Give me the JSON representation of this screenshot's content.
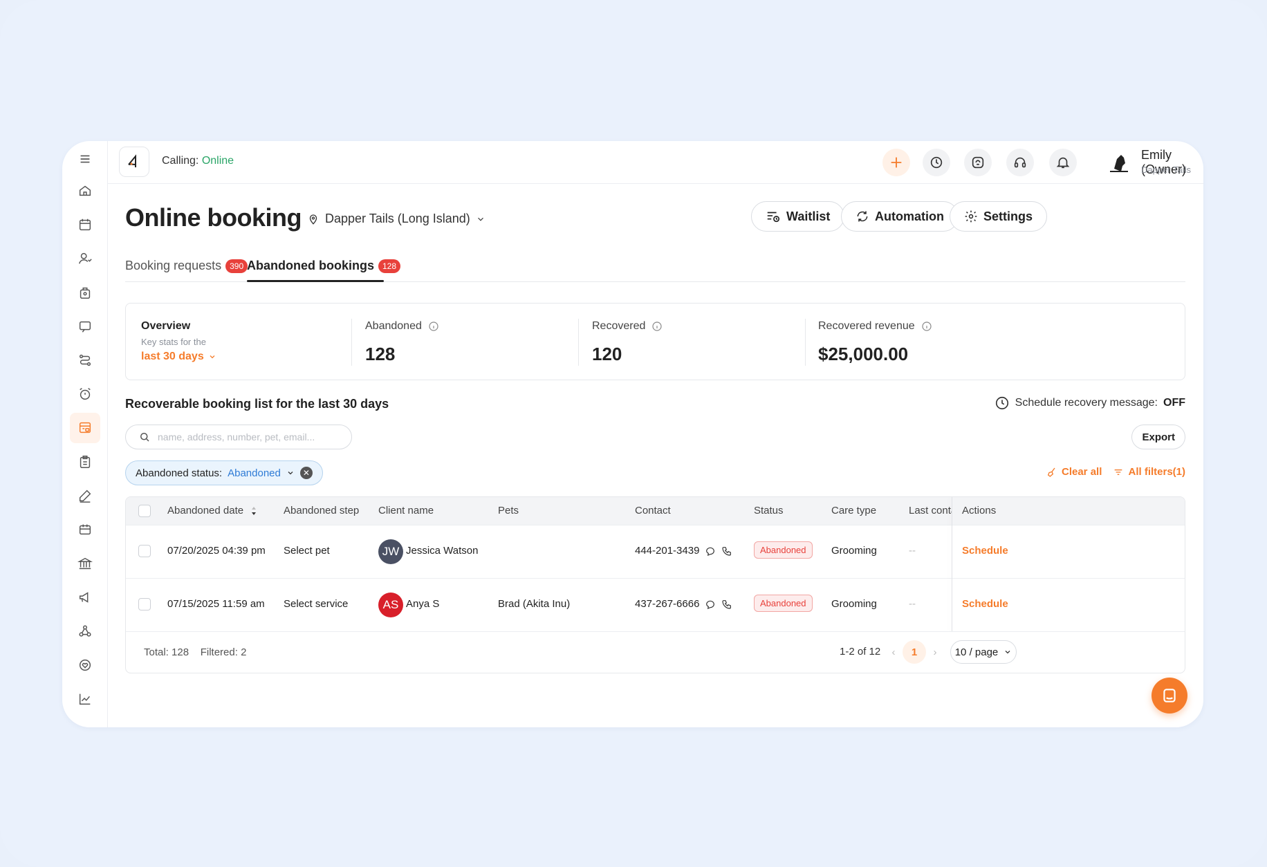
{
  "topbar": {
    "calling_label": "Calling:",
    "calling_status": "Online",
    "user_name": "Emily (Owner)",
    "user_business": "Dapper Tails",
    "icons": [
      "plus-icon",
      "clock-icon",
      "agent-icon",
      "headset-icon",
      "bell-icon"
    ]
  },
  "sidebar": {
    "items": [
      "menu-icon",
      "home-icon",
      "calendar-icon",
      "client-icon",
      "pet-bag-icon",
      "message-icon",
      "workflow-icon",
      "alarm-icon",
      "online-booking-icon",
      "clipboard-icon",
      "pen-icon",
      "ticket-icon",
      "bank-icon",
      "megaphone-icon",
      "network-icon",
      "heart-icon",
      "chart-icon"
    ]
  },
  "page": {
    "title": "Online booking",
    "location": "Dapper Tails (Long Island)",
    "buttons": {
      "waitlist": "Waitlist",
      "automation": "Automation",
      "settings": "Settings"
    }
  },
  "tabs": [
    {
      "label": "Booking requests",
      "count": "390"
    },
    {
      "label": "Abandoned bookings",
      "count": "128"
    }
  ],
  "overview": {
    "title": "Overview",
    "subtitle": "Key stats for the",
    "range": "last 30 days",
    "stats": [
      {
        "label": "Abandoned",
        "value": "128"
      },
      {
        "label": "Recovered",
        "value": "120"
      },
      {
        "label": "Recovered revenue",
        "value": "$25,000.00"
      }
    ]
  },
  "list": {
    "title": "Recoverable booking list for the last 30 days",
    "schedule_label": "Schedule recovery message:",
    "schedule_value": "OFF",
    "search_placeholder": "name, address, number, pet, email...",
    "export_label": "Export",
    "filter_chip_label": "Abandoned status:",
    "filter_chip_value": "Abandoned",
    "clear_all": "Clear all",
    "all_filters": "All filters(1)"
  },
  "table": {
    "columns": [
      "Abandoned date",
      "Abandoned step",
      "Client name",
      "Pets",
      "Contact",
      "Status",
      "Care type",
      "Last conta",
      "Actions"
    ],
    "rows": [
      {
        "date": "07/20/2025 04:39 pm",
        "step": "Select pet",
        "initials": "JW",
        "avatar_color": "#4a5063",
        "client": "Jessica Watson",
        "pets": "",
        "contact": "444-201-3439",
        "status": "Abandoned",
        "care": "Grooming",
        "last": "--",
        "action": "Schedule"
      },
      {
        "date": "07/15/2025 11:59 am",
        "step": "Select service",
        "initials": "AS",
        "avatar_color": "#d81f2a",
        "client": "Anya S",
        "pets": "Brad (Akita Inu)",
        "contact": "437-267-6666",
        "status": "Abandoned",
        "care": "Grooming",
        "last": "--",
        "action": "Schedule"
      }
    ],
    "footer": {
      "total": "Total: 128",
      "filtered": "Filtered: 2",
      "range": "1-2 of 12",
      "current_page": "1",
      "page_size": "10 / page"
    }
  },
  "colors": {
    "accent": "#f57c2b",
    "online": "#2aa567",
    "danger": "#e8413b",
    "filter": "#2e7bd6"
  }
}
